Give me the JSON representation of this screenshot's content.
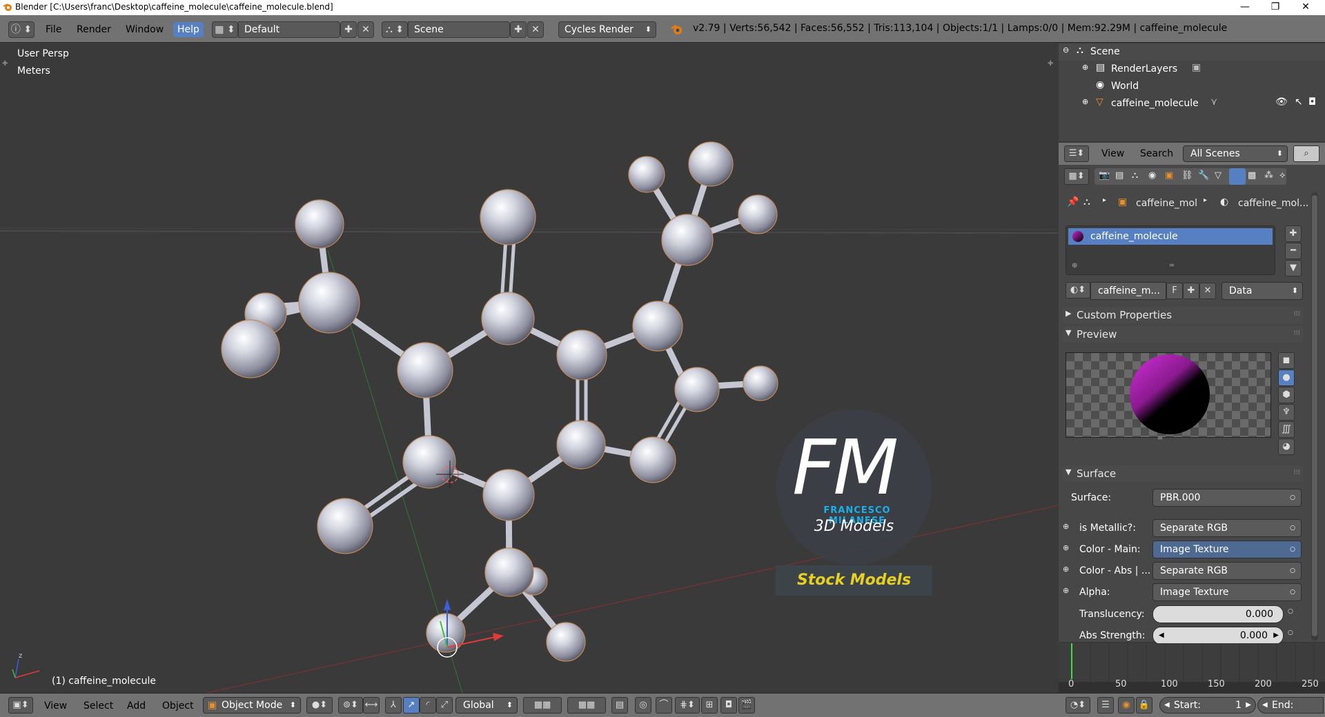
{
  "window": {
    "title": "Blender [C:\\Users\\franc\\Desktop\\caffeine_molecule\\caffeine_molecule.blend]",
    "minimize": "—",
    "maximize": "❐",
    "close": "✕"
  },
  "infobar": {
    "menus": [
      "File",
      "Render",
      "Window",
      "Help"
    ],
    "layout": "Default",
    "scene": "Scene",
    "engine": "Cycles Render",
    "stats": "v2.79 | Verts:56,542 | Faces:56,552 | Tris:113,104 | Objects:1/1 | Lamps:0/0 | Mem:92.29M | caffeine_molecule"
  },
  "viewport": {
    "view_name": "User Persp",
    "units": "Meters",
    "object_label": "(1) caffeine_molecule"
  },
  "watermark": {
    "logo": "FM",
    "name": "FRANCESCO MILANESE",
    "sub": "3D Models",
    "stock": "Stock Models"
  },
  "outliner": {
    "items": [
      {
        "label": "Scene"
      },
      {
        "label": "RenderLayers"
      },
      {
        "label": "World"
      },
      {
        "label": "caffeine_molecule"
      }
    ]
  },
  "propbar": {
    "view": "View",
    "search": "Search",
    "scenes": "All Scenes"
  },
  "properties": {
    "breadcrumb_object": "caffeine_mol",
    "breadcrumb_material": "caffeine_mol...",
    "material_slot": "caffeine_molecule",
    "material_name": "caffeine_m...",
    "fake_user": "F",
    "link": "Data",
    "custom_properties": "Custom Properties",
    "preview": "Preview",
    "surface_header": "Surface",
    "surface_label": "Surface:",
    "surface_value": "PBR.000",
    "rows": [
      {
        "label": "is Metallic?:",
        "value": "Separate RGB"
      },
      {
        "label": "Color - Main:",
        "value": "Image Texture"
      },
      {
        "label": "Color - Abs | ...",
        "value": "Separate RGB"
      },
      {
        "label": "Alpha:",
        "value": "Image Texture"
      }
    ],
    "translucency_label": "Translucency:",
    "translucency_value": "0.000",
    "abs_strength_label": "Abs Strength:",
    "abs_strength_value": "0.000"
  },
  "timeline": {
    "ticks": [
      "0",
      "50",
      "100",
      "150",
      "200",
      "250"
    ]
  },
  "bottombar": {
    "menus": [
      "View",
      "Select",
      "Add",
      "Object"
    ],
    "mode": "Object Mode",
    "orientation": "Global",
    "start_label": "Start:",
    "start_value": "1",
    "end_label": "End:"
  }
}
